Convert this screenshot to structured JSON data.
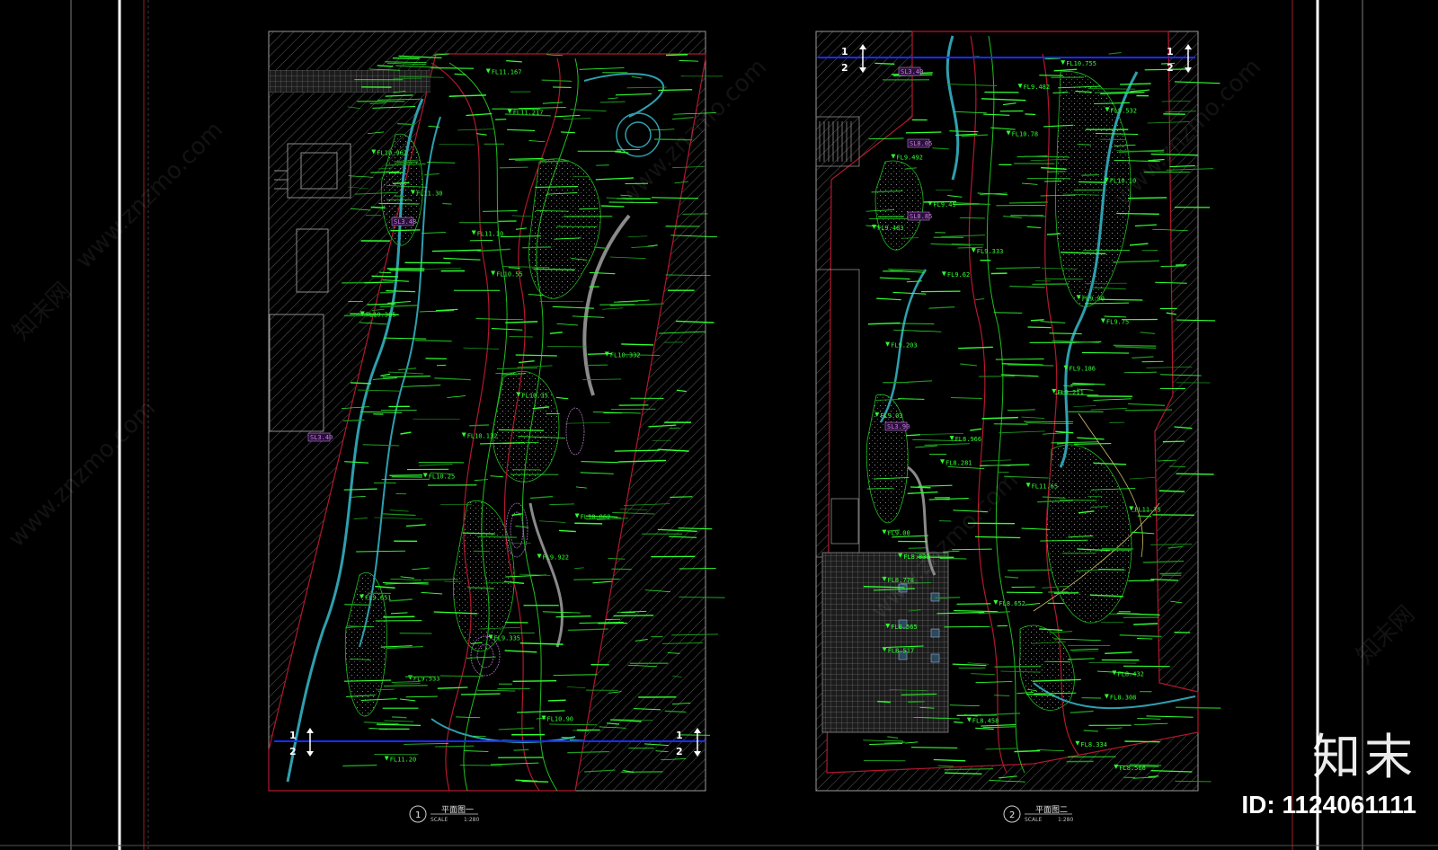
{
  "colors": {
    "background": "#000000",
    "grid_line": "#1fbf1f",
    "annotation": "#31ff31",
    "path_red": "#b3182e",
    "path_cyan": "#2f9fae",
    "section_line": "#1a2cff",
    "hatch": "#6b6b6b",
    "border": "#9a9a9a"
  },
  "plans": [
    {
      "number": "1",
      "title": "平面图一",
      "scale_label": "SCALE",
      "scale_value": "1:280",
      "section_top": "1",
      "section_bottom": "2",
      "elevations": [
        "FL11.167",
        "FL11.217",
        "FL10.962",
        "FL11.30",
        "FL11.10",
        "FL10.55",
        "FL10.385",
        "FL10.332",
        "FL10.35",
        "FL10.132",
        "FL10.25",
        "FL10.062",
        "FL9.922",
        "FL9.651",
        "FL9.335",
        "FL9.533",
        "FL10.90",
        "FL11.20"
      ],
      "tags": [
        "SL3.48",
        "SL3.40"
      ]
    },
    {
      "number": "2",
      "title": "平面图二",
      "scale_label": "SCALE",
      "scale_value": "1:280",
      "section_top": "1",
      "section_bottom": "2",
      "elevations": [
        "FL10.755",
        "FL9.482",
        "FL9.532",
        "FL10.78",
        "FL9.492",
        "FL10.10",
        "FL9.45",
        "FL9.483",
        "FL9.333",
        "FL9.62",
        "FL9.90",
        "FL9.75",
        "FL9.203",
        "FL9.186",
        "FL9.211",
        "FL9.03",
        "FL8.966",
        "FL8.281",
        "FL11.65",
        "FL11.75",
        "FL9.00",
        "FL8.833",
        "FL8.778",
        "FL8.652",
        "FL8.565",
        "FL8.517",
        "FL8.432",
        "FL8.308",
        "FL8.458",
        "FL8.334",
        "FL8.566"
      ],
      "tags": [
        "SL3.40",
        "SL8.05",
        "SL8.85",
        "SL3.90"
      ]
    }
  ],
  "watermark": {
    "text": "www.znzmo.com",
    "text_cn": "知末网"
  },
  "brand": {
    "logo": "知末",
    "id_text": "ID: 1124061111"
  }
}
